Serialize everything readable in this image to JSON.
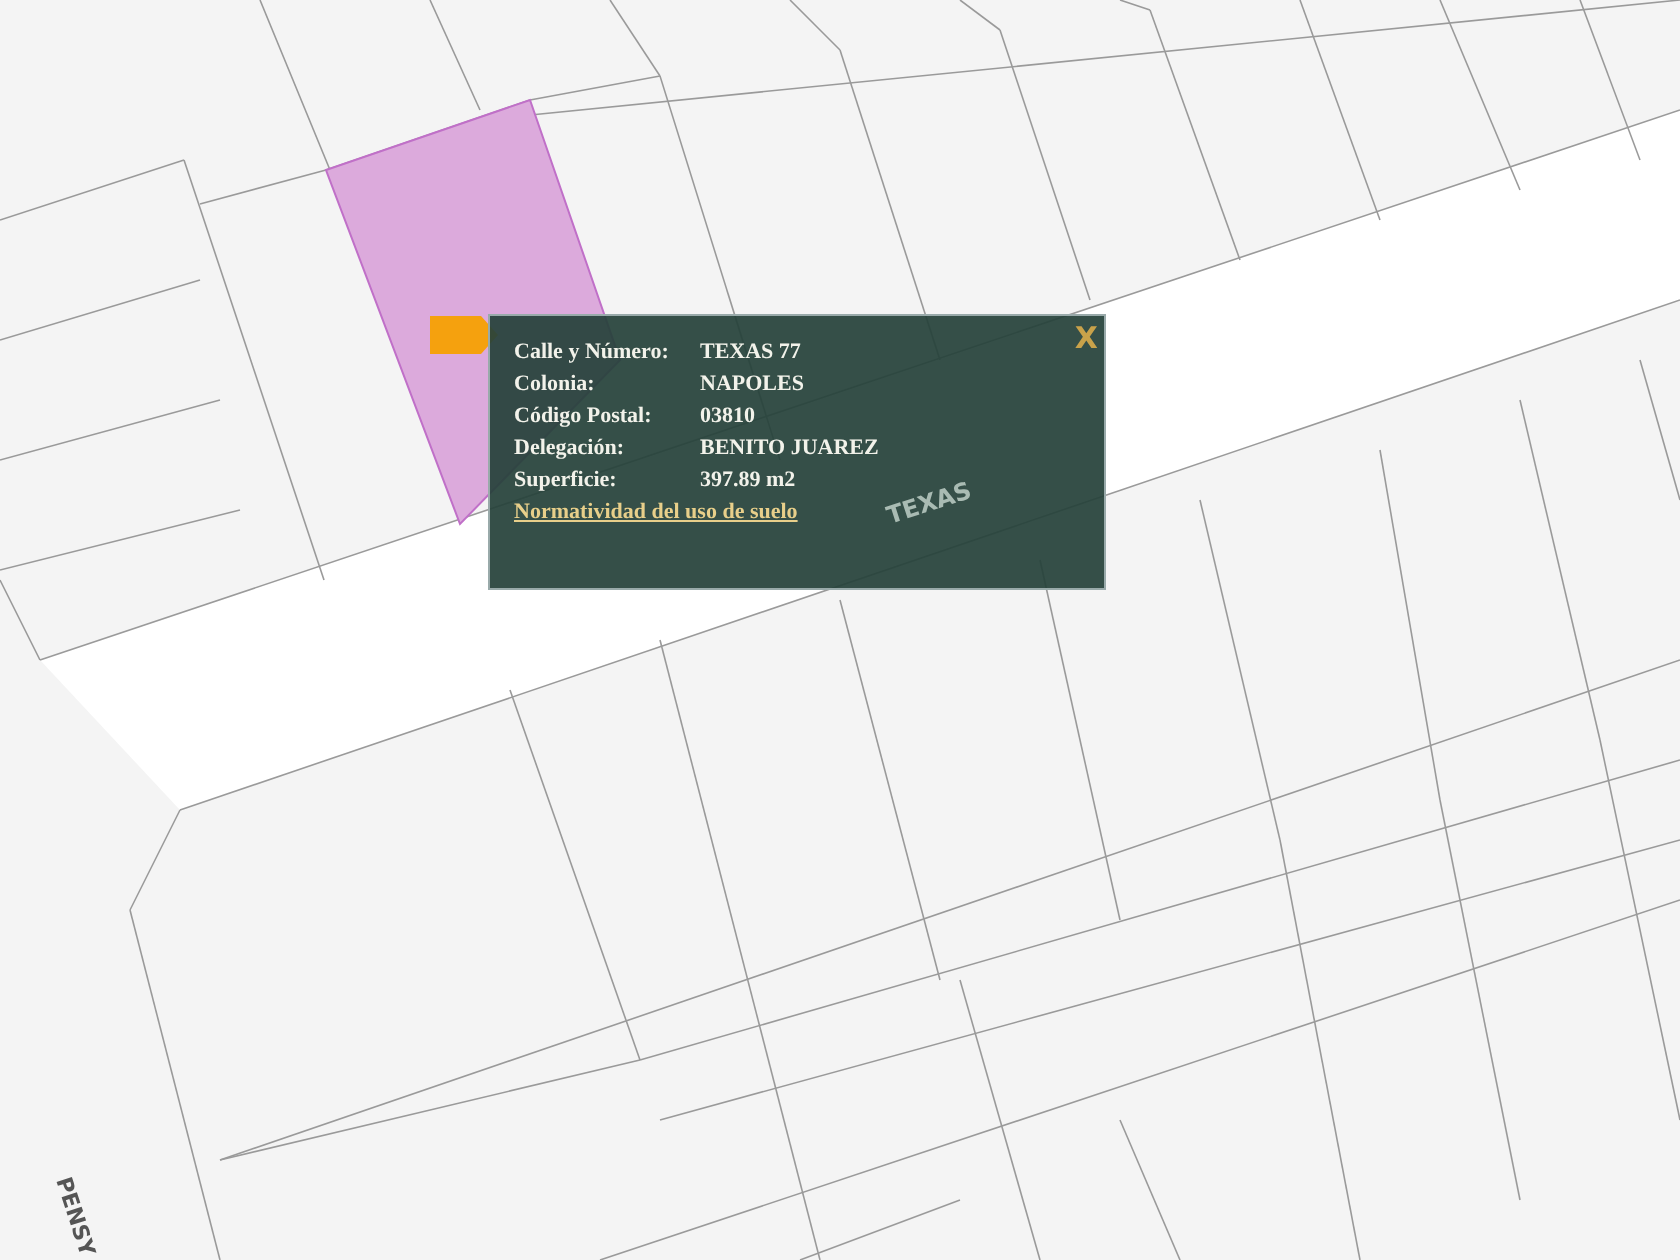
{
  "map": {
    "street_labels": [
      {
        "text": "TEXAS"
      },
      {
        "text": "PENSY"
      }
    ]
  },
  "popup": {
    "close": "X",
    "rows": [
      {
        "label": "Calle y Número:",
        "value": "TEXAS 77"
      },
      {
        "label": "Colonia:",
        "value": "NAPOLES"
      },
      {
        "label": "Código Postal:",
        "value": "03810"
      },
      {
        "label": "Delegación:",
        "value": "BENITO JUAREZ"
      },
      {
        "label": "Superficie:",
        "value": "397.89 m2"
      }
    ],
    "link": "Normatividad del uso de suelo"
  }
}
